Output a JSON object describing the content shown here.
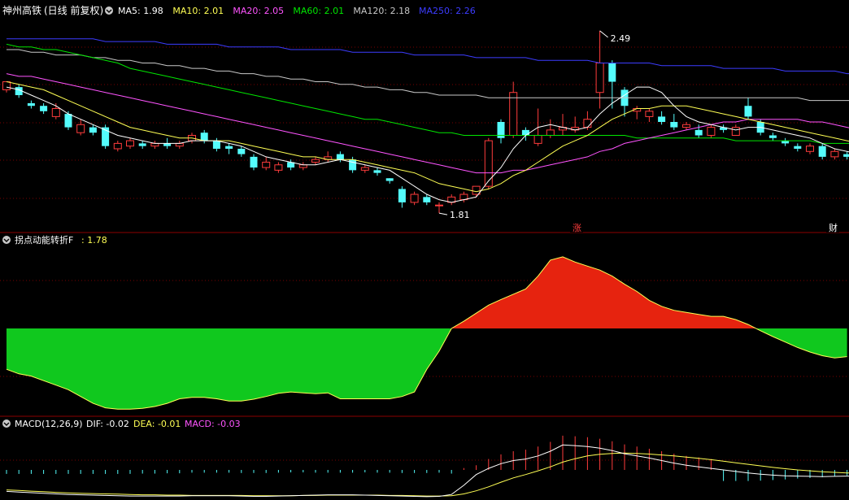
{
  "title": "神州高铁",
  "title_mode": "(日线 前复权)",
  "colors": {
    "up": "#ff3c3c",
    "down": "#54fcfc",
    "ma5": "#ffffff",
    "ma10": "#ffff54",
    "ma20": "#ff54ff",
    "ma60": "#00e600",
    "ma120": "#c8c8c8",
    "ma250": "#3c3cff",
    "panel_border": "#8b0000",
    "grid": "#7a0000",
    "fill_pos": "#e6230f",
    "fill_neg": "#10c81e"
  },
  "legend_ma": [
    {
      "label": "MA5: 1.98",
      "color": "#ffffff"
    },
    {
      "label": "MA10: 2.01",
      "color": "#ffff54"
    },
    {
      "label": "MA20: 2.05",
      "color": "#ff54ff"
    },
    {
      "label": "MA60: 2.01",
      "color": "#00e600"
    },
    {
      "label": "MA120: 2.18",
      "color": "#c8c8c8"
    },
    {
      "label": "MA250: 2.26",
      "color": "#3c3cff"
    }
  ],
  "high_label": "2.49",
  "low_label": "1.81",
  "markers": {
    "zhang": "涨",
    "cai": "财"
  },
  "panel2": {
    "title": "拐点动能转折F",
    "value_label": ": 1.78"
  },
  "panel3": {
    "title": "MACD(12,26,9)",
    "dif_label": "DIF: -0.02",
    "dea_label": "DEA: -0.01",
    "macd_label": "MACD: -0.03"
  },
  "chart_data": [
    {
      "type": "candlestick",
      "ylim": [
        1.78,
        2.52
      ],
      "candles": [
        [
          2.27,
          2.3,
          2.29,
          2.26
        ],
        [
          2.28,
          2.25,
          2.29,
          2.24
        ],
        [
          2.22,
          2.21,
          2.23,
          2.2
        ],
        [
          2.21,
          2.19,
          2.22,
          2.18
        ],
        [
          2.17,
          2.2,
          2.22,
          2.16
        ],
        [
          2.18,
          2.13,
          2.19,
          2.12
        ],
        [
          2.11,
          2.14,
          2.16,
          2.1
        ],
        [
          2.13,
          2.11,
          2.14,
          2.1
        ],
        [
          2.13,
          2.06,
          2.14,
          2.05
        ],
        [
          2.05,
          2.07,
          2.08,
          2.04
        ],
        [
          2.06,
          2.08,
          2.09,
          2.05
        ],
        [
          2.07,
          2.06,
          2.08,
          2.05
        ],
        [
          2.06,
          2.07,
          2.08,
          2.05
        ],
        [
          2.07,
          2.06,
          2.09,
          2.05
        ],
        [
          2.06,
          2.07,
          2.08,
          2.05
        ],
        [
          2.08,
          2.1,
          2.11,
          2.07
        ],
        [
          2.11,
          2.08,
          2.12,
          2.07
        ],
        [
          2.08,
          2.05,
          2.09,
          2.04
        ],
        [
          2.06,
          2.05,
          2.07,
          2.03
        ],
        [
          2.05,
          2.03,
          2.06,
          2.02
        ],
        [
          2.02,
          1.98,
          2.03,
          1.97
        ],
        [
          1.98,
          2.0,
          2.02,
          1.97
        ],
        [
          1.97,
          1.99,
          2.0,
          1.96
        ],
        [
          2.0,
          1.98,
          2.01,
          1.97
        ],
        [
          1.98,
          1.99,
          2.0,
          1.97
        ],
        [
          2.0,
          2.01,
          2.02,
          1.99
        ],
        [
          2.01,
          2.02,
          2.04,
          2.0
        ],
        [
          2.03,
          2.01,
          2.04,
          2.0
        ],
        [
          2.01,
          1.97,
          2.02,
          1.96
        ],
        [
          1.97,
          1.98,
          1.99,
          1.96
        ],
        [
          1.97,
          1.96,
          1.98,
          1.95
        ],
        [
          1.94,
          1.93,
          1.94,
          1.92
        ],
        [
          1.9,
          1.85,
          1.91,
          1.83
        ],
        [
          1.85,
          1.88,
          1.89,
          1.84
        ],
        [
          1.87,
          1.85,
          1.88,
          1.84
        ],
        [
          1.84,
          1.84,
          1.85,
          1.81
        ],
        [
          1.85,
          1.87,
          1.88,
          1.84
        ],
        [
          1.86,
          1.88,
          1.89,
          1.85
        ],
        [
          1.88,
          1.91,
          1.91,
          1.87
        ],
        [
          1.91,
          2.08,
          2.09,
          1.9
        ],
        [
          2.15,
          2.09,
          2.16,
          2.07
        ],
        [
          2.1,
          2.26,
          2.3,
          2.09
        ],
        [
          2.12,
          2.1,
          2.13,
          2.08
        ],
        [
          2.07,
          2.1,
          2.2,
          2.06
        ],
        [
          2.1,
          2.12,
          2.16,
          2.09
        ],
        [
          2.12,
          2.13,
          2.18,
          2.1
        ],
        [
          2.12,
          2.13,
          2.17,
          2.11
        ],
        [
          2.13,
          2.16,
          2.19,
          2.12
        ],
        [
          2.26,
          2.37,
          2.49,
          2.2
        ],
        [
          2.37,
          2.3,
          2.38,
          2.2
        ],
        [
          2.27,
          2.21,
          2.28,
          2.17
        ],
        [
          2.19,
          2.2,
          2.21,
          2.16
        ],
        [
          2.17,
          2.19,
          2.2,
          2.15
        ],
        [
          2.17,
          2.15,
          2.19,
          2.14
        ],
        [
          2.15,
          2.13,
          2.18,
          2.12
        ],
        [
          2.13,
          2.14,
          2.15,
          2.12
        ],
        [
          2.12,
          2.1,
          2.14,
          2.09
        ],
        [
          2.1,
          2.13,
          2.14,
          2.09
        ],
        [
          2.13,
          2.12,
          2.14,
          2.11
        ],
        [
          2.1,
          2.13,
          2.14,
          2.1
        ],
        [
          2.21,
          2.17,
          2.24,
          2.16
        ],
        [
          2.15,
          2.11,
          2.16,
          2.1
        ],
        [
          2.1,
          2.09,
          2.11,
          2.08
        ],
        [
          2.08,
          2.07,
          2.09,
          2.06
        ],
        [
          2.06,
          2.05,
          2.07,
          2.04
        ],
        [
          2.04,
          2.06,
          2.07,
          2.03
        ],
        [
          2.06,
          2.02,
          2.07,
          2.01
        ],
        [
          2.02,
          2.04,
          2.05,
          2.01
        ],
        [
          2.03,
          2.02,
          2.04,
          2.01
        ],
        [
          2.02,
          2.06,
          2.07,
          2.0
        ]
      ],
      "ma5": [
        2.28,
        2.27,
        2.25,
        2.23,
        2.21,
        2.18,
        2.16,
        2.14,
        2.12,
        2.1,
        2.09,
        2.08,
        2.07,
        2.07,
        2.07,
        2.08,
        2.08,
        2.08,
        2.07,
        2.06,
        2.04,
        2.02,
        2.01,
        2.0,
        1.99,
        1.99,
        2.0,
        2.01,
        2.0,
        1.99,
        1.98,
        1.97,
        1.94,
        1.91,
        1.88,
        1.86,
        1.85,
        1.86,
        1.87,
        1.93,
        1.98,
        2.05,
        2.1,
        2.13,
        2.14,
        2.13,
        2.12,
        2.13,
        2.18,
        2.22,
        2.25,
        2.28,
        2.28,
        2.26,
        2.21,
        2.17,
        2.15,
        2.14,
        2.13,
        2.12,
        2.13,
        2.13,
        2.12,
        2.11,
        2.1,
        2.09,
        2.07,
        2.05,
        2.04,
        2.03
      ],
      "ma10": [
        2.3,
        2.29,
        2.28,
        2.27,
        2.25,
        2.23,
        2.21,
        2.19,
        2.17,
        2.15,
        2.13,
        2.12,
        2.11,
        2.1,
        2.09,
        2.09,
        2.08,
        2.08,
        2.08,
        2.07,
        2.06,
        2.05,
        2.04,
        2.03,
        2.02,
        2.02,
        2.01,
        2.01,
        2.01,
        2.0,
        1.99,
        1.98,
        1.97,
        1.96,
        1.94,
        1.92,
        1.91,
        1.9,
        1.89,
        1.9,
        1.92,
        1.95,
        1.97,
        2.0,
        2.03,
        2.06,
        2.08,
        2.1,
        2.13,
        2.16,
        2.18,
        2.2,
        2.2,
        2.21,
        2.21,
        2.21,
        2.2,
        2.19,
        2.18,
        2.17,
        2.16,
        2.15,
        2.14,
        2.13,
        2.12,
        2.11,
        2.1,
        2.09,
        2.08,
        2.07
      ],
      "ma20": [
        2.33,
        2.32,
        2.32,
        2.31,
        2.3,
        2.29,
        2.28,
        2.27,
        2.26,
        2.25,
        2.24,
        2.23,
        2.22,
        2.21,
        2.2,
        2.19,
        2.18,
        2.17,
        2.16,
        2.15,
        2.14,
        2.13,
        2.12,
        2.11,
        2.1,
        2.09,
        2.08,
        2.07,
        2.06,
        2.05,
        2.04,
        2.03,
        2.02,
        2.01,
        2.0,
        1.99,
        1.98,
        1.97,
        1.96,
        1.96,
        1.96,
        1.97,
        1.97,
        1.98,
        1.99,
        2.0,
        2.01,
        2.02,
        2.04,
        2.05,
        2.07,
        2.08,
        2.09,
        2.1,
        2.11,
        2.12,
        2.13,
        2.14,
        2.15,
        2.15,
        2.16,
        2.16,
        2.16,
        2.16,
        2.16,
        2.15,
        2.15,
        2.14,
        2.13,
        2.12
      ],
      "ma60": [
        2.44,
        2.43,
        2.43,
        2.42,
        2.42,
        2.41,
        2.4,
        2.39,
        2.38,
        2.37,
        2.35,
        2.34,
        2.33,
        2.32,
        2.31,
        2.3,
        2.29,
        2.28,
        2.27,
        2.26,
        2.25,
        2.24,
        2.23,
        2.22,
        2.21,
        2.2,
        2.19,
        2.18,
        2.17,
        2.16,
        2.16,
        2.15,
        2.14,
        2.13,
        2.12,
        2.11,
        2.11,
        2.1,
        2.1,
        2.1,
        2.1,
        2.1,
        2.1,
        2.1,
        2.1,
        2.1,
        2.1,
        2.1,
        2.1,
        2.1,
        2.1,
        2.09,
        2.09,
        2.09,
        2.09,
        2.09,
        2.09,
        2.09,
        2.09,
        2.08,
        2.08,
        2.08,
        2.08,
        2.08,
        2.08,
        2.08,
        2.07,
        2.07,
        2.07,
        2.07
      ],
      "ma120": [
        2.42,
        2.42,
        2.41,
        2.41,
        2.4,
        2.4,
        2.4,
        2.39,
        2.39,
        2.38,
        2.38,
        2.37,
        2.37,
        2.36,
        2.36,
        2.35,
        2.35,
        2.34,
        2.34,
        2.33,
        2.33,
        2.32,
        2.32,
        2.31,
        2.31,
        2.3,
        2.3,
        2.29,
        2.29,
        2.28,
        2.28,
        2.27,
        2.27,
        2.26,
        2.26,
        2.25,
        2.25,
        2.25,
        2.25,
        2.24,
        2.24,
        2.24,
        2.24,
        2.24,
        2.24,
        2.24,
        2.24,
        2.24,
        2.24,
        2.24,
        2.24,
        2.24,
        2.24,
        2.24,
        2.24,
        2.24,
        2.24,
        2.24,
        2.24,
        2.24,
        2.24,
        2.24,
        2.24,
        2.24,
        2.24,
        2.23,
        2.23,
        2.23,
        2.23,
        2.23
      ],
      "ma250": [
        2.46,
        2.46,
        2.46,
        2.46,
        2.46,
        2.46,
        2.46,
        2.46,
        2.45,
        2.45,
        2.45,
        2.45,
        2.45,
        2.44,
        2.44,
        2.44,
        2.44,
        2.44,
        2.43,
        2.43,
        2.43,
        2.43,
        2.43,
        2.42,
        2.42,
        2.42,
        2.42,
        2.42,
        2.41,
        2.41,
        2.41,
        2.41,
        2.41,
        2.4,
        2.4,
        2.4,
        2.4,
        2.4,
        2.39,
        2.39,
        2.39,
        2.39,
        2.39,
        2.38,
        2.38,
        2.38,
        2.38,
        2.38,
        2.37,
        2.37,
        2.37,
        2.37,
        2.37,
        2.36,
        2.36,
        2.36,
        2.36,
        2.36,
        2.35,
        2.35,
        2.35,
        2.35,
        2.35,
        2.34,
        2.34,
        2.34,
        2.34,
        2.34,
        2.33,
        2.33
      ]
    },
    {
      "type": "area",
      "ylim": [
        -1.9,
        2.0
      ],
      "values": [
        -0.9,
        -1.0,
        -1.05,
        -1.15,
        -1.25,
        -1.35,
        -1.5,
        -1.65,
        -1.75,
        -1.78,
        -1.78,
        -1.76,
        -1.72,
        -1.65,
        -1.55,
        -1.52,
        -1.52,
        -1.55,
        -1.6,
        -1.6,
        -1.56,
        -1.5,
        -1.43,
        -1.4,
        -1.42,
        -1.44,
        -1.42,
        -1.55,
        -1.55,
        -1.55,
        -1.55,
        -1.55,
        -1.5,
        -1.4,
        -0.9,
        -0.5,
        0.0,
        0.18,
        0.38,
        0.58,
        0.72,
        0.85,
        0.98,
        1.3,
        1.7,
        1.78,
        1.65,
        1.55,
        1.45,
        1.3,
        1.1,
        0.92,
        0.7,
        0.55,
        0.45,
        0.4,
        0.35,
        0.3,
        0.3,
        0.22,
        0.1,
        -0.05,
        -0.18,
        -0.3,
        -0.42,
        -0.52,
        -0.6,
        -0.65,
        -0.62
      ]
    },
    {
      "type": "line",
      "ylim": [
        -0.09,
        0.12
      ],
      "dif": [
        -0.07,
        -0.072,
        -0.074,
        -0.076,
        -0.078,
        -0.08,
        -0.081,
        -0.082,
        -0.083,
        -0.084,
        -0.085,
        -0.085,
        -0.085,
        -0.085,
        -0.085,
        -0.084,
        -0.084,
        -0.084,
        -0.084,
        -0.085,
        -0.086,
        -0.086,
        -0.085,
        -0.084,
        -0.083,
        -0.082,
        -0.081,
        -0.081,
        -0.081,
        -0.082,
        -0.083,
        -0.084,
        -0.085,
        -0.086,
        -0.087,
        -0.086,
        -0.08,
        -0.05,
        -0.015,
        0.005,
        0.02,
        0.03,
        0.035,
        0.045,
        0.06,
        0.08,
        0.078,
        0.075,
        0.07,
        0.062,
        0.052,
        0.045,
        0.038,
        0.03,
        0.022,
        0.015,
        0.01,
        0.005,
        0.0,
        -0.005,
        -0.01,
        -0.014,
        -0.017,
        -0.019,
        -0.02,
        -0.021,
        -0.022,
        -0.021,
        -0.02,
        -0.02
      ],
      "dea": [
        -0.065,
        -0.067,
        -0.069,
        -0.071,
        -0.073,
        -0.075,
        -0.076,
        -0.077,
        -0.078,
        -0.079,
        -0.08,
        -0.081,
        -0.081,
        -0.082,
        -0.082,
        -0.083,
        -0.083,
        -0.083,
        -0.083,
        -0.083,
        -0.084,
        -0.084,
        -0.084,
        -0.084,
        -0.083,
        -0.083,
        -0.082,
        -0.082,
        -0.082,
        -0.082,
        -0.082,
        -0.083,
        -0.083,
        -0.084,
        -0.085,
        -0.085,
        -0.084,
        -0.078,
        -0.068,
        -0.055,
        -0.04,
        -0.026,
        -0.015,
        -0.003,
        0.01,
        0.025,
        0.036,
        0.045,
        0.05,
        0.053,
        0.054,
        0.053,
        0.051,
        0.048,
        0.045,
        0.041,
        0.037,
        0.033,
        0.028,
        0.023,
        0.018,
        0.013,
        0.008,
        0.004,
        0.0,
        -0.003,
        -0.006,
        -0.008,
        -0.01,
        -0.01
      ]
    }
  ]
}
